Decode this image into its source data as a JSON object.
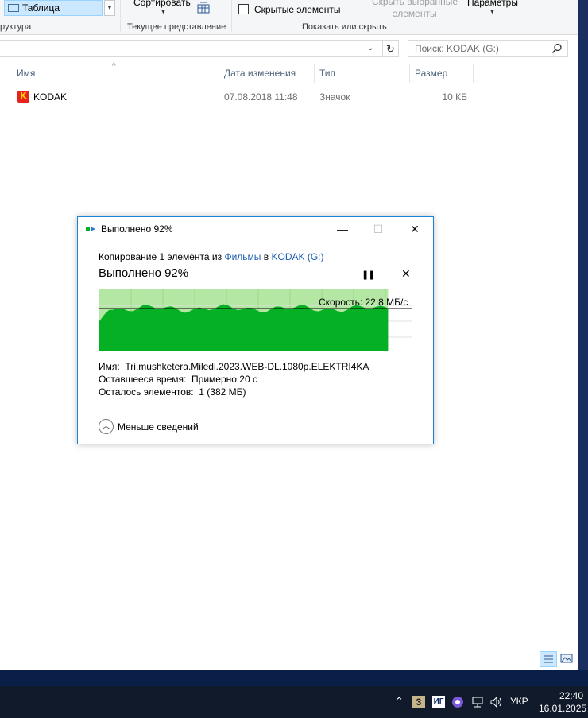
{
  "ribbon": {
    "table_label": "Таблица",
    "structure_label": "руктура",
    "sort_label": "Сортировать",
    "current_view_label": "Текущее представление",
    "hidden_items_label": "Скрытые элементы",
    "hide_selected_line1": "Скрыть выбранные",
    "hide_selected_line2": "элементы",
    "show_hide_label": "Показать или скрыть",
    "params_label": "Параметры"
  },
  "address": {
    "search_placeholder": "Поиск: KODAK (G:)"
  },
  "columns": {
    "name": "Имя",
    "date": "Дата изменения",
    "type": "Тип",
    "size": "Размер"
  },
  "files": [
    {
      "name": "KODAK",
      "date": "07.08.2018 11:48",
      "type": "Значок",
      "size": "10 КБ"
    }
  ],
  "dialog": {
    "title": "Выполнено 92%",
    "desc_prefix": "Копирование 1 элемента из ",
    "desc_src": "Фильмы",
    "desc_mid": " в ",
    "desc_dst": "KODAK (G:)",
    "big_status": "Выполнено 92%",
    "speed": "Скорость: 22,8 МБ/с",
    "progress_percent": 92,
    "name_label": "Имя:",
    "name_value": "Tri.mushketera.Miledi.2023.WEB-DL.1080p.ELEKTRI4KA",
    "time_label": "Оставшееся время:",
    "time_value": "Примерно 20 с",
    "items_label": "Осталось элементов:",
    "items_value": "1 (382 МБ)",
    "less_details": "Меньше сведений",
    "accent": "#1883d7",
    "graph_fill": "#06b025",
    "graph_bg": "#b5e7a4"
  },
  "taskbar": {
    "lang": "УКР",
    "time": "22:40",
    "date": "16.01.2025"
  }
}
